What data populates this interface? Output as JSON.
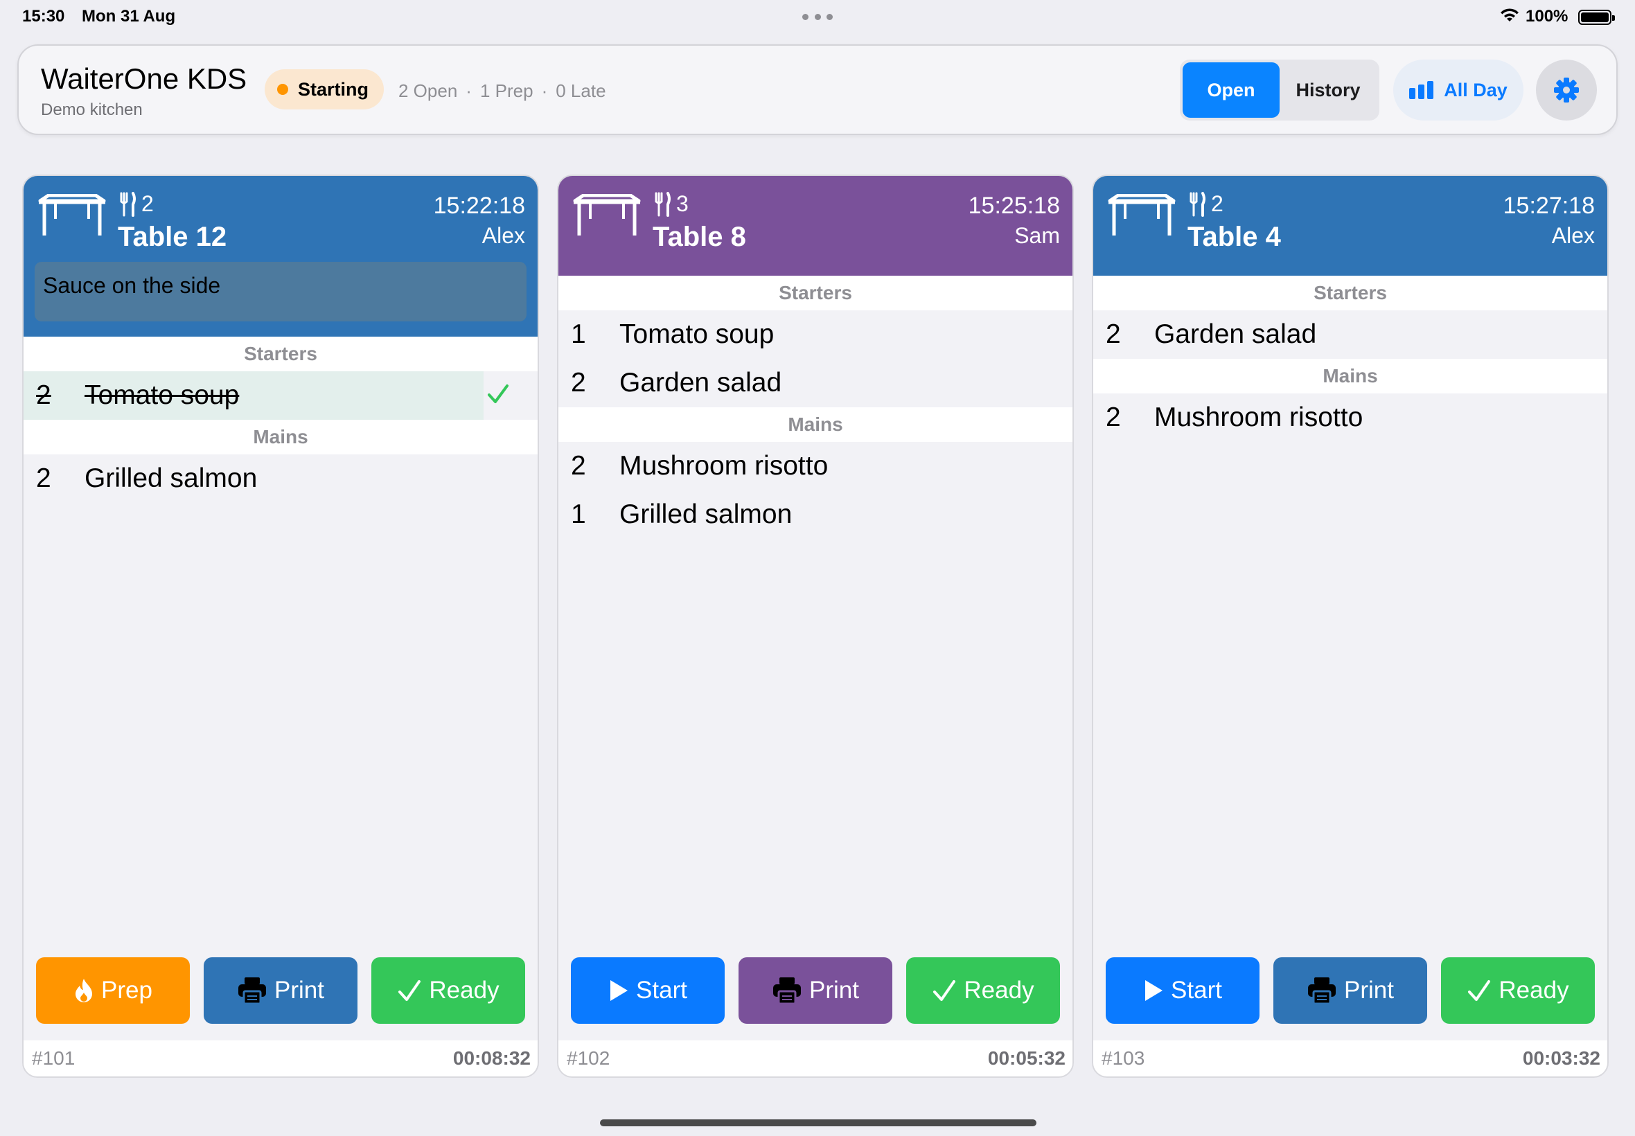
{
  "status_bar": {
    "time": "15:30",
    "date": "Mon 31 Aug",
    "battery": "100%"
  },
  "header": {
    "title": "WaiterOne KDS",
    "subtitle": "Demo kitchen",
    "status": "Starting",
    "counts": [
      "2 Open",
      "1 Prep",
      "0 Late"
    ],
    "separator": "·",
    "tabs": [
      "Open",
      "History"
    ],
    "active_tab": "Open",
    "all_day_label": "All Day"
  },
  "colors": {
    "blue_header": "#2f74b5",
    "purple_header": "#7a519a",
    "accent": "#0a84ff",
    "prep": "#ff9500",
    "ready": "#34c759"
  },
  "cards": [
    {
      "guests": "2",
      "table": "Table 12",
      "time": "15:22:18",
      "waiter": "Alex",
      "note": "Sauce on the side",
      "courses": [
        {
          "name": "Starters",
          "items": [
            {
              "qty": "2",
              "name": "Tomato soup",
              "done": true
            }
          ]
        },
        {
          "name": "Mains",
          "items": [
            {
              "qty": "2",
              "name": "Grilled salmon",
              "done": false
            }
          ]
        }
      ],
      "actions": [
        "Prep",
        "Print",
        "Ready"
      ],
      "order_no": "#101",
      "elapsed": "00:08:32"
    },
    {
      "guests": "3",
      "table": "Table 8",
      "time": "15:25:18",
      "waiter": "Sam",
      "courses": [
        {
          "name": "Starters",
          "items": [
            {
              "qty": "1",
              "name": "Tomato soup"
            },
            {
              "qty": "2",
              "name": "Garden salad"
            }
          ]
        },
        {
          "name": "Mains",
          "items": [
            {
              "qty": "2",
              "name": "Mushroom risotto"
            },
            {
              "qty": "1",
              "name": "Grilled salmon"
            }
          ]
        }
      ],
      "actions": [
        "Start",
        "Print",
        "Ready"
      ],
      "order_no": "#102",
      "elapsed": "00:05:32"
    },
    {
      "guests": "2",
      "table": "Table 4",
      "time": "15:27:18",
      "waiter": "Alex",
      "courses": [
        {
          "name": "Starters",
          "items": [
            {
              "qty": "2",
              "name": "Garden salad"
            }
          ]
        },
        {
          "name": "Mains",
          "items": [
            {
              "qty": "2",
              "name": "Mushroom risotto"
            }
          ]
        }
      ],
      "actions": [
        "Start",
        "Print",
        "Ready"
      ],
      "order_no": "#103",
      "elapsed": "00:03:32"
    }
  ]
}
